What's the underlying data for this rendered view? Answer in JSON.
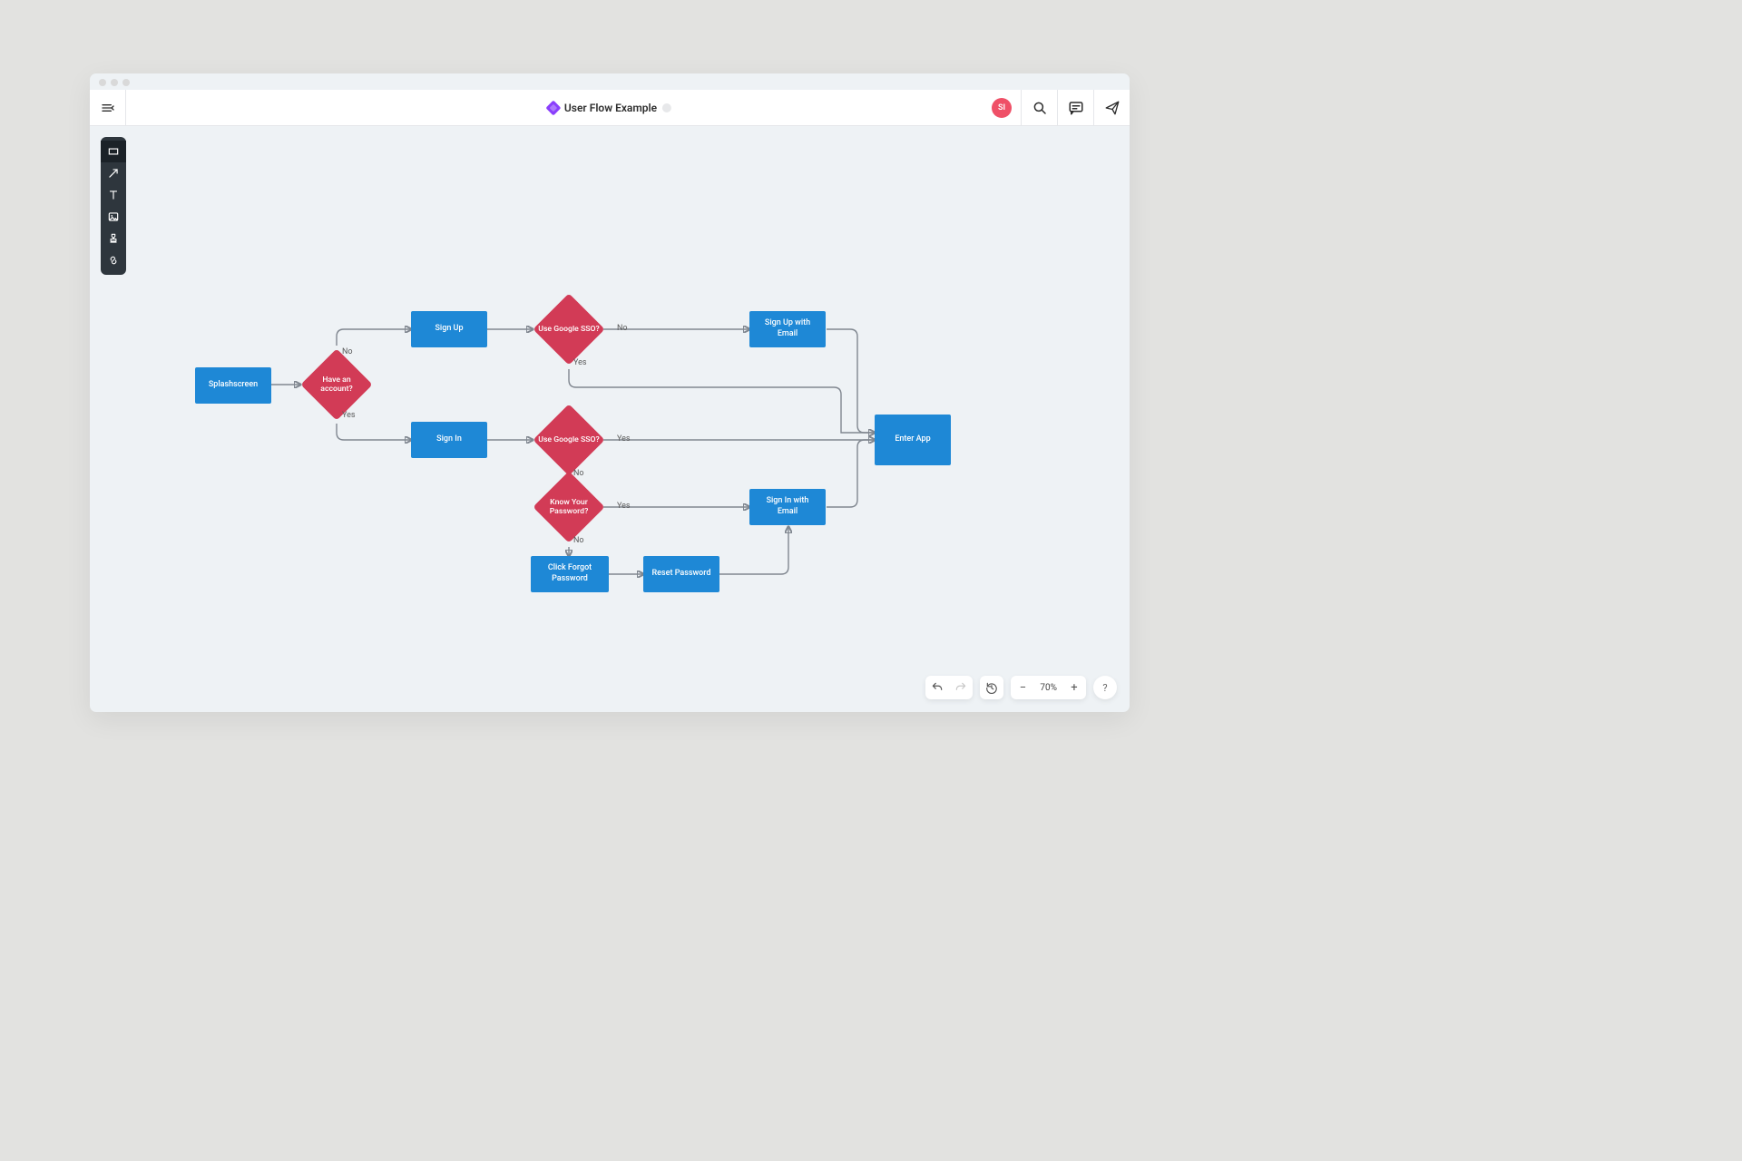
{
  "header": {
    "title": "User Flow Example",
    "avatar_initials": "SI"
  },
  "nodes": {
    "splash": "Splashscreen",
    "have_account": "Have an account?",
    "signup": "Sign Up",
    "signin": "Sign In",
    "sso_up": "Use Google SSO?",
    "sso_in": "Use Google SSO?",
    "signup_email": "Sign Up with Email",
    "know_pw": "Know Your Password?",
    "signin_email": "Sign In with Email",
    "click_forgot": "Click Forgot Password",
    "reset_pw": "Reset Password",
    "enter_app": "Enter App"
  },
  "labels": {
    "yes": "Yes",
    "no": "No"
  },
  "zoom": {
    "value": "70%"
  },
  "help": {
    "label": "?"
  },
  "colors": {
    "process": "#1e88d6",
    "decision": "#d23b56",
    "accent_purple": "#8a3ffc",
    "avatar": "#ef5067"
  },
  "chart_data": {
    "type": "flowchart",
    "title": "User Flow Example",
    "nodes": [
      {
        "id": "splash",
        "kind": "process",
        "label": "Splashscreen"
      },
      {
        "id": "have_account",
        "kind": "decision",
        "label": "Have an account?"
      },
      {
        "id": "signup",
        "kind": "process",
        "label": "Sign Up"
      },
      {
        "id": "signin",
        "kind": "process",
        "label": "Sign In"
      },
      {
        "id": "sso_up",
        "kind": "decision",
        "label": "Use Google SSO?"
      },
      {
        "id": "sso_in",
        "kind": "decision",
        "label": "Use Google SSO?"
      },
      {
        "id": "signup_email",
        "kind": "process",
        "label": "Sign Up with Email"
      },
      {
        "id": "know_pw",
        "kind": "decision",
        "label": "Know Your Password?"
      },
      {
        "id": "signin_email",
        "kind": "process",
        "label": "Sign In with Email"
      },
      {
        "id": "click_forgot",
        "kind": "process",
        "label": "Click Forgot Password"
      },
      {
        "id": "reset_pw",
        "kind": "process",
        "label": "Reset Password"
      },
      {
        "id": "enter_app",
        "kind": "process",
        "label": "Enter App"
      }
    ],
    "edges": [
      {
        "from": "splash",
        "to": "have_account",
        "label": null
      },
      {
        "from": "have_account",
        "to": "signup",
        "label": "No"
      },
      {
        "from": "have_account",
        "to": "signin",
        "label": "Yes"
      },
      {
        "from": "signup",
        "to": "sso_up",
        "label": null
      },
      {
        "from": "sso_up",
        "to": "signup_email",
        "label": "No"
      },
      {
        "from": "sso_up",
        "to": "enter_app",
        "label": "Yes"
      },
      {
        "from": "signin",
        "to": "sso_in",
        "label": null
      },
      {
        "from": "sso_in",
        "to": "enter_app",
        "label": "Yes"
      },
      {
        "from": "sso_in",
        "to": "know_pw",
        "label": "No"
      },
      {
        "from": "know_pw",
        "to": "signin_email",
        "label": "Yes"
      },
      {
        "from": "know_pw",
        "to": "click_forgot",
        "label": "No"
      },
      {
        "from": "click_forgot",
        "to": "reset_pw",
        "label": null
      },
      {
        "from": "reset_pw",
        "to": "signin_email",
        "label": null
      },
      {
        "from": "signup_email",
        "to": "enter_app",
        "label": null
      },
      {
        "from": "signin_email",
        "to": "enter_app",
        "label": null
      }
    ]
  }
}
